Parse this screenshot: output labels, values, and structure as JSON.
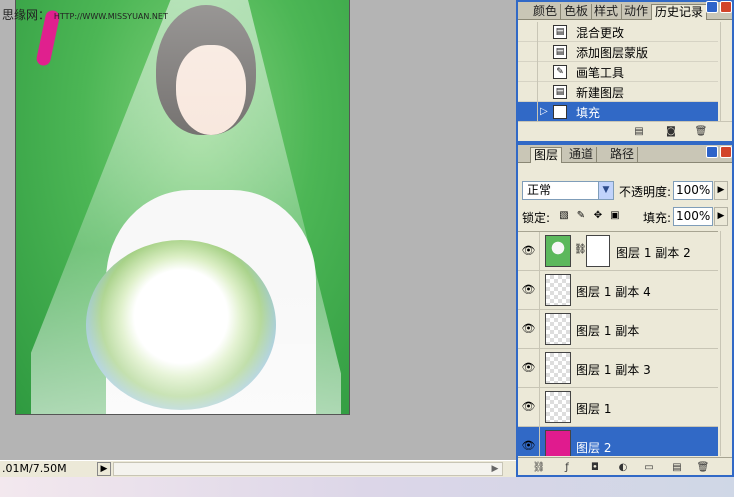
{
  "watermark": {
    "site": "思缘网：",
    "url": "HTTP://WWW.MISSYUAN.NET"
  },
  "status": {
    "doc_size": ".01M/7.50M",
    "arrow": "▶",
    "scroll_arrow": "▶"
  },
  "history_panel": {
    "tabs": [
      {
        "label": "颜色",
        "active": false
      },
      {
        "label": "色板",
        "active": false
      },
      {
        "label": "样式",
        "active": false
      },
      {
        "label": "动作",
        "active": false
      },
      {
        "label": "历史记录",
        "active": true
      }
    ],
    "items": [
      {
        "label": "混合更改",
        "icon": "history-state-icon",
        "selected": false
      },
      {
        "label": "添加图层蒙版",
        "icon": "history-state-icon",
        "selected": false
      },
      {
        "label": "画笔工具",
        "icon": "brush-icon",
        "selected": false
      },
      {
        "label": "新建图层",
        "icon": "history-state-icon",
        "selected": false
      },
      {
        "label": "填充",
        "icon": "history-state-icon",
        "selected": true
      }
    ]
  },
  "layers_panel": {
    "tabs": [
      {
        "label": "图层",
        "active": true
      },
      {
        "label": "通道",
        "active": false
      },
      {
        "label": "路径",
        "active": false
      }
    ],
    "blend_mode": "正常",
    "opacity_label": "不透明度:",
    "opacity_value": "100%",
    "lock_label": "锁定:",
    "fill_label": "填充:",
    "fill_value": "100%",
    "layers": [
      {
        "name": "图层 1 副本 2",
        "visible": true,
        "thumb": "photo",
        "has_mask": true,
        "selected": false
      },
      {
        "name": "图层 1 副本 4",
        "visible": true,
        "thumb": "transparent",
        "has_mask": false,
        "selected": false
      },
      {
        "name": "图层 1 副本",
        "visible": true,
        "thumb": "transparent",
        "has_mask": false,
        "selected": false
      },
      {
        "name": "图层 1 副本 3",
        "visible": true,
        "thumb": "transparent",
        "has_mask": false,
        "selected": false
      },
      {
        "name": "图层 1",
        "visible": true,
        "thumb": "transparent",
        "has_mask": false,
        "selected": false
      },
      {
        "name": "图层 2",
        "visible": true,
        "thumb": "magenta",
        "has_mask": false,
        "selected": true
      }
    ]
  },
  "colors": {
    "selection": "#3169c6",
    "panel_bg": "#ece9d8",
    "fill_layer": "#e01b8e",
    "backdrop": "#4cb655"
  }
}
